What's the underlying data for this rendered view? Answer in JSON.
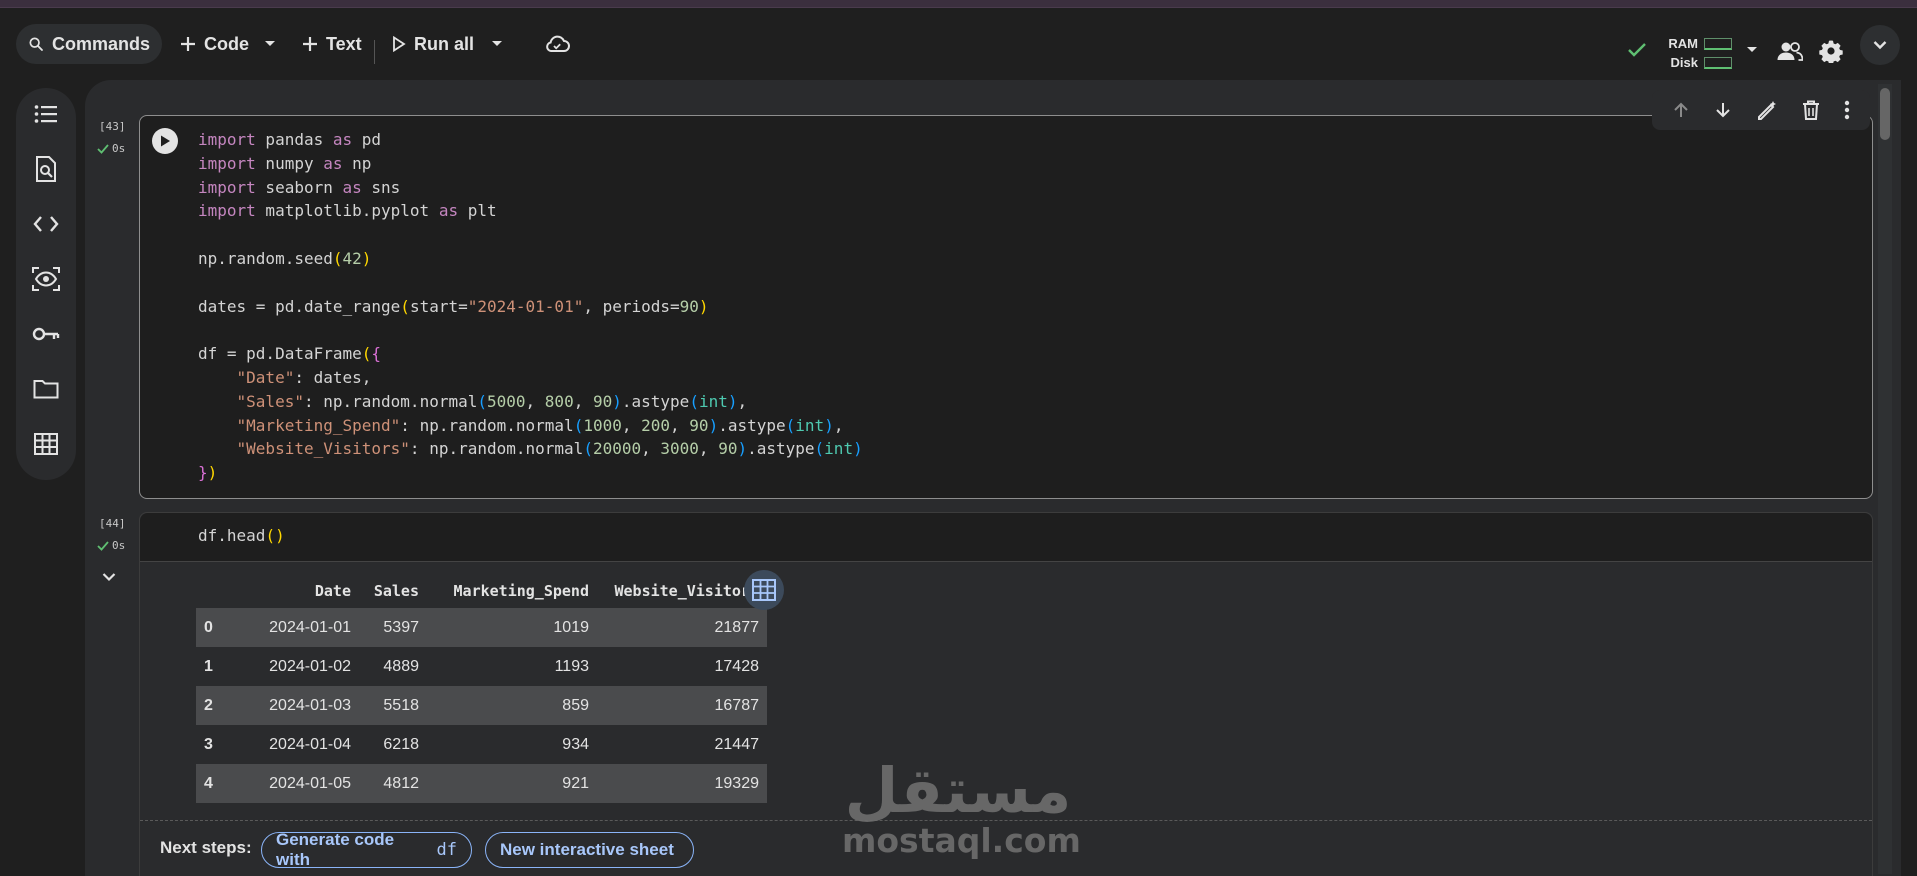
{
  "toolbar": {
    "commands_label": "Commands",
    "code_label": "Code",
    "text_label": "Text",
    "run_all_label": "Run all",
    "ram_label": "RAM",
    "disk_label": "Disk"
  },
  "cells": [
    {
      "exec_count": "[43]",
      "exec_time": "0s",
      "code_lines": [
        "import pandas as pd",
        "import numpy as np",
        "import seaborn as sns",
        "import matplotlib.pyplot as plt",
        "",
        "np.random.seed(42)",
        "",
        "dates = pd.date_range(start=\"2024-01-01\", periods=90)",
        "",
        "df = pd.DataFrame({",
        "    \"Date\": dates,",
        "    \"Sales\": np.random.normal(5000, 800, 90).astype(int),",
        "    \"Marketing_Spend\": np.random.normal(1000, 200, 90).astype(int),",
        "    \"Website_Visitors\": np.random.normal(20000, 3000, 90).astype(int)",
        "})"
      ]
    },
    {
      "exec_count": "[44]",
      "exec_time": "0s",
      "code_lines": [
        "df.head()"
      ]
    }
  ],
  "dataframe": {
    "columns": [
      "",
      "Date",
      "Sales",
      "Marketing_Spend",
      "Website_Visitors"
    ],
    "rows": [
      [
        "0",
        "2024-01-01",
        "5397",
        "1019",
        "21877"
      ],
      [
        "1",
        "2024-01-02",
        "4889",
        "1193",
        "17428"
      ],
      [
        "2",
        "2024-01-03",
        "5518",
        "859",
        "16787"
      ],
      [
        "3",
        "2024-01-04",
        "6218",
        "934",
        "21447"
      ],
      [
        "4",
        "2024-01-05",
        "4812",
        "921",
        "19329"
      ]
    ]
  },
  "next_steps": {
    "label": "Next steps:",
    "generate_label": "Generate code with",
    "generate_var": "df",
    "sheet_label": "New interactive sheet"
  },
  "watermark": {
    "arabic": "مستقل",
    "latin": "mostaql.com"
  },
  "icons": {
    "sidebar": [
      "toc-icon",
      "find-icon",
      "code-snippets-icon",
      "variables-icon",
      "secrets-icon",
      "files-icon",
      "data-table-icon"
    ]
  }
}
